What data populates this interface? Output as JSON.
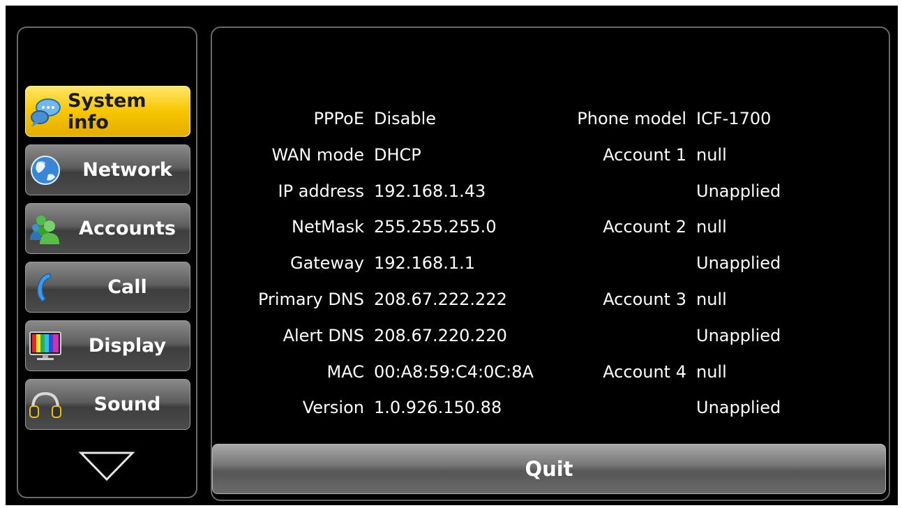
{
  "sidebar": {
    "items": [
      {
        "label": "System info",
        "icon": "chat-bubble-icon",
        "active": true
      },
      {
        "label": "Network",
        "icon": "globe-icon",
        "active": false
      },
      {
        "label": "Accounts",
        "icon": "users-icon",
        "active": false
      },
      {
        "label": "Call",
        "icon": "phone-handset-icon",
        "active": false
      },
      {
        "label": "Display",
        "icon": "monitor-icon",
        "active": false
      },
      {
        "label": "Sound",
        "icon": "headphones-icon",
        "active": false
      }
    ],
    "scroll_icon": "triangle-down-icon"
  },
  "info": {
    "left": [
      {
        "key": "PPPoE",
        "value": "Disable"
      },
      {
        "key": "WAN mode",
        "value": "DHCP"
      },
      {
        "key": "IP address",
        "value": "192.168.1.43"
      },
      {
        "key": "NetMask",
        "value": "255.255.255.0"
      },
      {
        "key": "Gateway",
        "value": "192.168.1.1"
      },
      {
        "key": "Primary DNS",
        "value": "208.67.222.222"
      },
      {
        "key": "Alert DNS",
        "value": "208.67.220.220"
      },
      {
        "key": "MAC",
        "value": "00:A8:59:C4:0C:8A"
      },
      {
        "key": "Version",
        "value": "1.0.926.150.88"
      }
    ],
    "right": [
      {
        "key": "Phone model",
        "value": "ICF-1700"
      },
      {
        "key": "Account 1",
        "value": "null"
      },
      {
        "key": "",
        "value": "Unapplied"
      },
      {
        "key": "Account 2",
        "value": "null"
      },
      {
        "key": "",
        "value": "Unapplied"
      },
      {
        "key": "Account 3",
        "value": "null"
      },
      {
        "key": "",
        "value": "Unapplied"
      },
      {
        "key": "Account 4",
        "value": "null"
      },
      {
        "key": "",
        "value": "Unapplied"
      }
    ]
  },
  "quit_label": "Quit",
  "colors": {
    "active": "#f7c600",
    "button": "#5e5e5e",
    "border": "#6a6a6a"
  }
}
